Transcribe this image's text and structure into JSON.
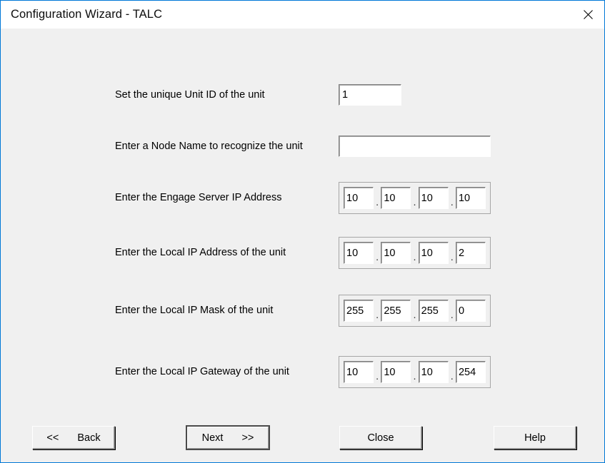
{
  "window": {
    "title": "Configuration Wizard - TALC",
    "close_icon": "close-icon",
    "accent_color": "#0078d7",
    "body_color": "#f0f0f0",
    "titlebar_color": "#ffffff"
  },
  "form": {
    "rows": [
      {
        "label": "Set the unique Unit ID of the unit",
        "type": "text",
        "value": "1",
        "placeholder": ""
      },
      {
        "label": "Enter a Node Name to recognize the unit",
        "type": "text",
        "value": "",
        "placeholder": ""
      },
      {
        "label": "Enter the Engage Server IP Address",
        "type": "ip",
        "octets": [
          "10",
          "10",
          "10",
          "10"
        ]
      },
      {
        "label": "Enter the Local IP Address of the unit",
        "type": "ip",
        "octets": [
          "10",
          "10",
          "10",
          "2"
        ]
      },
      {
        "label": "Enter the Local IP Mask of the unit",
        "type": "ip",
        "octets": [
          "255",
          "255",
          "255",
          "0"
        ]
      },
      {
        "label": "Enter the Local IP Gateway of the unit",
        "type": "ip",
        "octets": [
          "10",
          "10",
          "10",
          "254"
        ]
      }
    ],
    "ip_separator": "."
  },
  "buttons": {
    "back": {
      "arrow": "<<",
      "label": "Back"
    },
    "next": {
      "label": "Next",
      "arrow": ">>",
      "is_default": true
    },
    "close": {
      "label": "Close"
    },
    "help": {
      "label": "Help"
    }
  }
}
